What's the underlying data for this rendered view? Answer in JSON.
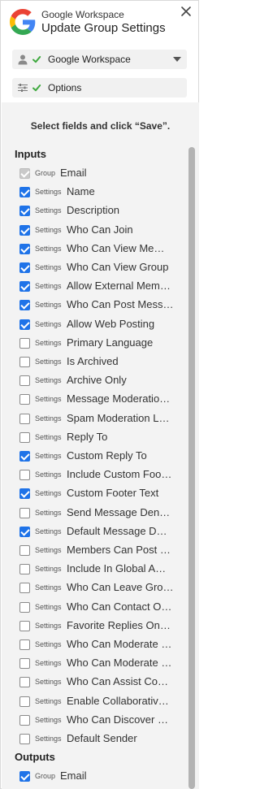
{
  "header": {
    "app_name": "Google Workspace",
    "title": "Update Group Settings"
  },
  "account": {
    "label": "Google Workspace"
  },
  "options": {
    "label": "Options"
  },
  "instruction": "Select fields and click “Save”.",
  "sections": {
    "inputs": "Inputs",
    "outputs": "Outputs"
  },
  "inputs": [
    {
      "tag": "Group",
      "name": "Email",
      "checked": true,
      "disabled": true
    },
    {
      "tag": "Settings",
      "name": "Name",
      "checked": true
    },
    {
      "tag": "Settings",
      "name": "Description",
      "checked": true
    },
    {
      "tag": "Settings",
      "name": "Who Can Join",
      "checked": true
    },
    {
      "tag": "Settings",
      "name": "Who Can View Me…",
      "checked": true
    },
    {
      "tag": "Settings",
      "name": "Who Can View Group",
      "checked": true
    },
    {
      "tag": "Settings",
      "name": "Allow External Mem…",
      "checked": true
    },
    {
      "tag": "Settings",
      "name": "Who Can Post Mess…",
      "checked": true
    },
    {
      "tag": "Settings",
      "name": "Allow Web Posting",
      "checked": true
    },
    {
      "tag": "Settings",
      "name": "Primary Language",
      "checked": false
    },
    {
      "tag": "Settings",
      "name": "Is Archived",
      "checked": false
    },
    {
      "tag": "Settings",
      "name": "Archive Only",
      "checked": false
    },
    {
      "tag": "Settings",
      "name": "Message Moderatio…",
      "checked": false
    },
    {
      "tag": "Settings",
      "name": "Spam Moderation L…",
      "checked": false
    },
    {
      "tag": "Settings",
      "name": "Reply To",
      "checked": false
    },
    {
      "tag": "Settings",
      "name": "Custom Reply To",
      "checked": true
    },
    {
      "tag": "Settings",
      "name": "Include Custom Foo…",
      "checked": false
    },
    {
      "tag": "Settings",
      "name": "Custom Footer Text",
      "checked": true
    },
    {
      "tag": "Settings",
      "name": "Send Message Den…",
      "checked": false
    },
    {
      "tag": "Settings",
      "name": "Default Message D…",
      "checked": true
    },
    {
      "tag": "Settings",
      "name": "Members Can Post …",
      "checked": false
    },
    {
      "tag": "Settings",
      "name": "Include In Global A…",
      "checked": false
    },
    {
      "tag": "Settings",
      "name": "Who Can Leave Gro…",
      "checked": false
    },
    {
      "tag": "Settings",
      "name": "Who Can Contact O…",
      "checked": false
    },
    {
      "tag": "Settings",
      "name": "Favorite Replies On…",
      "checked": false
    },
    {
      "tag": "Settings",
      "name": "Who Can Moderate …",
      "checked": false
    },
    {
      "tag": "Settings",
      "name": "Who Can Moderate …",
      "checked": false
    },
    {
      "tag": "Settings",
      "name": "Who Can Assist Co…",
      "checked": false
    },
    {
      "tag": "Settings",
      "name": "Enable Collaborativ…",
      "checked": false
    },
    {
      "tag": "Settings",
      "name": "Who Can Discover …",
      "checked": false
    },
    {
      "tag": "Settings",
      "name": "Default Sender",
      "checked": false
    }
  ],
  "outputs": [
    {
      "tag": "Group",
      "name": "Email",
      "checked": true
    }
  ],
  "colors": {
    "accent": "#1f73e8",
    "check_green": "#3fa93f",
    "panel_bg": "#f3f3f3"
  }
}
